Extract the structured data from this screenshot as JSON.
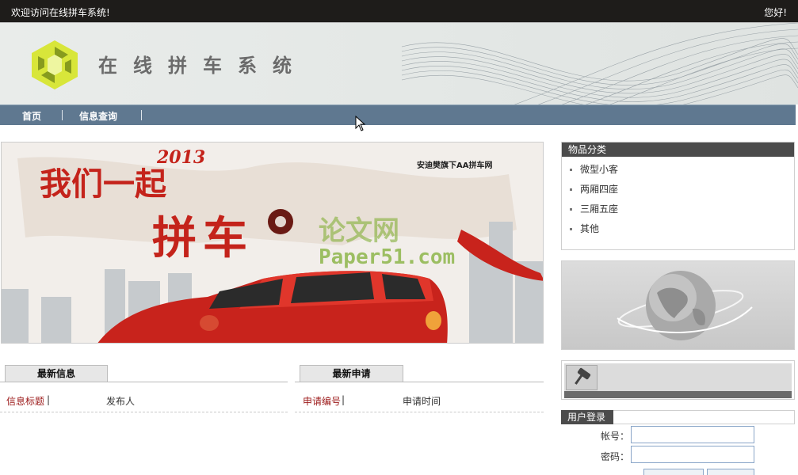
{
  "topbar": {
    "welcome": "欢迎访问在线拼车系统!",
    "greeting": "您好!"
  },
  "banner": {
    "title": "在线拼车系统"
  },
  "nav": {
    "items": [
      "首页",
      "信息查询"
    ]
  },
  "hero": {
    "headline": "我们一起",
    "year": "2013",
    "slogan": "拼车",
    "brand": "安迪樊旗下AA拼车网",
    "watermark_cn": "论文网",
    "watermark_en": "Paper51.com"
  },
  "latest_info": {
    "title": "最新信息",
    "columns": [
      "信息标题",
      "发布人"
    ]
  },
  "latest_apply": {
    "title": "最新申请",
    "columns": [
      "申请编号",
      "申请时间"
    ]
  },
  "categories": {
    "title": "物品分类",
    "items": [
      "微型小客",
      "两厢四座",
      "三厢五座",
      "其他"
    ]
  },
  "login": {
    "title": "用户登录",
    "account_label": "帐号：",
    "password_label": "密码：",
    "account_value": "",
    "password_value": ""
  },
  "colors": {
    "nav": "#5f7890",
    "topbar": "#1e1c1a",
    "accent_red": "#9c1a1a"
  }
}
